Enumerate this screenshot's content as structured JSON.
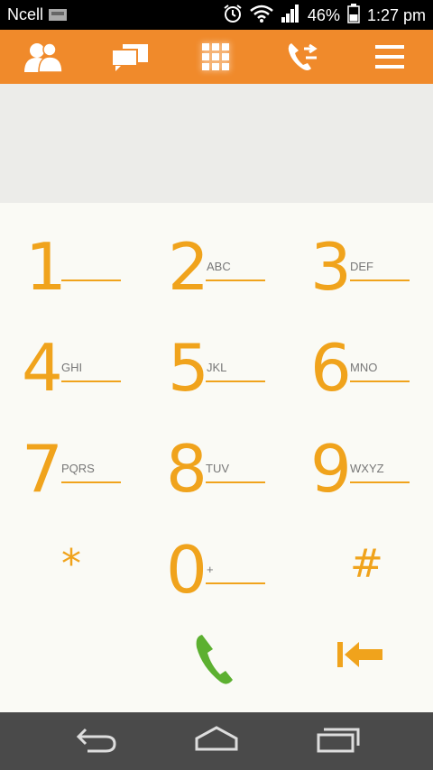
{
  "status_bar": {
    "carrier": "Ncell",
    "battery": "46%",
    "time": "1:27 pm",
    "icons": [
      "sim-icon",
      "alarm-icon",
      "wifi-icon",
      "signal-icon",
      "battery-icon"
    ]
  },
  "tabs": [
    {
      "name": "contacts-tab",
      "icon": "contacts-icon"
    },
    {
      "name": "messages-tab",
      "icon": "chat-icon"
    },
    {
      "name": "dialpad-tab",
      "icon": "keypad-icon"
    },
    {
      "name": "call-log-tab",
      "icon": "call-log-icon"
    },
    {
      "name": "menu-tab",
      "icon": "menu-icon"
    }
  ],
  "dialpad": {
    "keys": [
      {
        "digit": "1",
        "letters": ""
      },
      {
        "digit": "2",
        "letters": "ABC"
      },
      {
        "digit": "3",
        "letters": "DEF"
      },
      {
        "digit": "4",
        "letters": "GHI"
      },
      {
        "digit": "5",
        "letters": "JKL"
      },
      {
        "digit": "6",
        "letters": "MNO"
      },
      {
        "digit": "7",
        "letters": "PQRS"
      },
      {
        "digit": "8",
        "letters": "TUV"
      },
      {
        "digit": "9",
        "letters": "WXYZ"
      },
      {
        "digit": "0",
        "letters": "+"
      }
    ],
    "star": "*",
    "hash": "#"
  },
  "actions": {
    "call_icon": "phone-icon",
    "backspace_icon": "backspace-icon"
  },
  "nav": {
    "icons": [
      "back-icon",
      "home-icon",
      "recents-icon"
    ]
  },
  "colors": {
    "accent": "#f08a2b",
    "digit": "#f0a31c",
    "call": "#5cb030",
    "nav_bg": "#4a4a4a"
  }
}
